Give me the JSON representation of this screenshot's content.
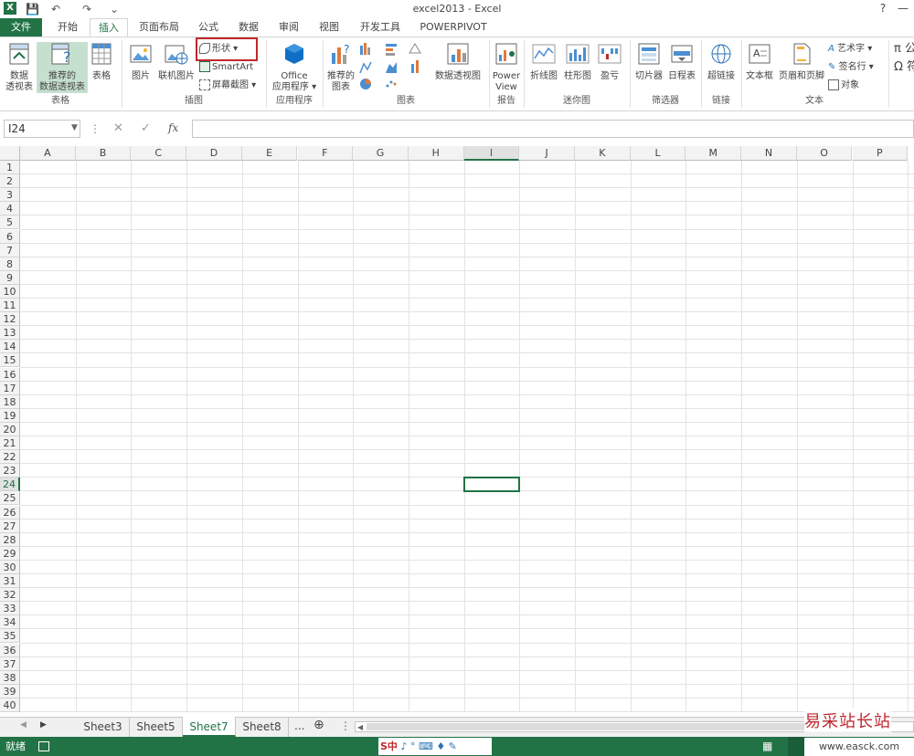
{
  "window": {
    "title": "excel2013 - Excel",
    "help": "?",
    "min": "—",
    "max": "□",
    "logo": "X"
  },
  "quick_access": {
    "save": "💾",
    "undo": "↶",
    "redo": "↷",
    "more": "⌄"
  },
  "tabs": [
    {
      "label": "文件"
    },
    {
      "label": "开始"
    },
    {
      "label": "插入"
    },
    {
      "label": "页面布局"
    },
    {
      "label": "公式"
    },
    {
      "label": "数据"
    },
    {
      "label": "审阅"
    },
    {
      "label": "视图"
    },
    {
      "label": "开发工具"
    },
    {
      "label": "POWERPIVOT"
    }
  ],
  "ribbon": {
    "tables": {
      "pivot_l1": "数据",
      "pivot_l2": "透视表",
      "rec_pivot_l1": "推荐的",
      "rec_pivot_l2": "数据透视表",
      "table": "表格",
      "group": "表格"
    },
    "illustrations": {
      "picture": "图片",
      "online_picture": "联机图片",
      "shapes": "形状 ▾",
      "smartart": "SmartArt",
      "screenshot": "屏幕截图 ▾",
      "group": "插图"
    },
    "apps": {
      "office_l1": "Office",
      "office_l2": "应用程序 ▾",
      "group": "应用程序"
    },
    "charts": {
      "recommended_l1": "推荐的",
      "recommended_l2": "图表",
      "pivot_chart": "数据透视图",
      "group": "图表"
    },
    "reports": {
      "pv_l1": "Power",
      "pv_l2": "View",
      "group": "报告"
    },
    "sparklines": {
      "line": "折线图",
      "column": "柱形图",
      "winloss": "盈亏",
      "group": "迷你图"
    },
    "filters": {
      "slicer": "切片器",
      "timeline": "日程表",
      "group": "筛选器"
    },
    "links": {
      "hyperlink": "超链接",
      "group": "链接"
    },
    "text": {
      "textbox": "文本框",
      "header_footer": "页眉和页脚",
      "wordart": "艺术字 ▾",
      "signature": "签名行 ▾",
      "object": "对象",
      "group": "文本"
    },
    "symbols": {
      "pi": "π",
      "omega": "Ω",
      "eq": "公",
      "sym": "符"
    }
  },
  "formula_bar": {
    "name_box": "I24",
    "cancel": "✕",
    "enter": "✓",
    "fx": "fx",
    "value": ""
  },
  "grid": {
    "columns": [
      "A",
      "B",
      "C",
      "D",
      "E",
      "F",
      "G",
      "H",
      "I",
      "J",
      "K",
      "L",
      "M",
      "N",
      "O",
      "P"
    ],
    "rows": [
      "1",
      "2",
      "3",
      "4",
      "5",
      "6",
      "7",
      "8",
      "9",
      "10",
      "11",
      "12",
      "13",
      "14",
      "15",
      "16",
      "17",
      "18",
      "19",
      "20",
      "21",
      "22",
      "23",
      "24",
      "25",
      "26",
      "27",
      "28",
      "29",
      "30",
      "31",
      "32",
      "33",
      "34",
      "35",
      "36",
      "37",
      "38",
      "39",
      "40"
    ],
    "active_col": "I",
    "active_row": "24"
  },
  "sheets": [
    {
      "label": "Sheet3"
    },
    {
      "label": "Sheet5"
    },
    {
      "label": "Sheet7"
    },
    {
      "label": "Sheet8"
    }
  ],
  "sheet_nav": {
    "prev": "◀",
    "next": "▶",
    "more": "...",
    "add": "⊕",
    "menu": "⋮"
  },
  "status": {
    "ready": "就绪",
    "ime": "S中",
    "ime_icons": "♪ ° ⌨ ♦ ✎"
  },
  "watermark": {
    "text": "易采站长站",
    "url": "www.easck.com"
  },
  "colors": {
    "excel_green": "#217346",
    "highlight_red": "#c0282d"
  }
}
